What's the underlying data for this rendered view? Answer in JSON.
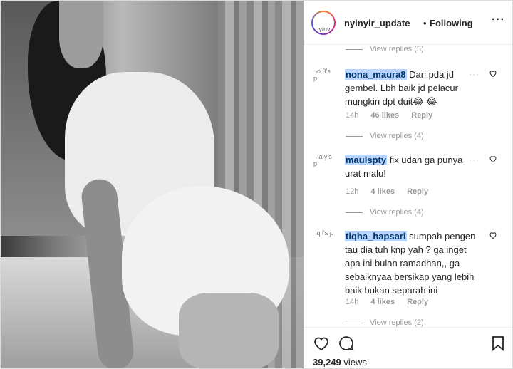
{
  "header": {
    "username": "nyinyir_update",
    "separator": "•",
    "follow_status": "Following",
    "more_label": "···",
    "avatar_alt": "nyinyi"
  },
  "comments": [
    {
      "avatar_alt": "no\n3's p",
      "username": "nona_maura8",
      "text": " Dari pda jd gembel. Lbh baik jd pelacur mungkin dpt duit😂 😂",
      "time": "14h",
      "likes": "46 likes",
      "reply": "Reply",
      "view_replies": "View replies (4)"
    },
    {
      "avatar_alt": "ma\ny's p",
      "username": "maulspty",
      "text": " fix udah ga punya urat malu!",
      "time": "12h",
      "likes": "4 likes",
      "reply": "Reply",
      "view_replies": "View replies (4)"
    },
    {
      "avatar_alt": "tiq\ni's p",
      "username": "tiqha_hapsari",
      "text": " sumpah pengen tau dia tuh knp yah ? ga inget apa ini bulan ramadhan,, ga sebaiknyaa bersikap yang lebih baik bukan separah ini",
      "time": "14h",
      "likes": "4 likes",
      "reply": "Reply",
      "view_replies": "View replies (2)"
    }
  ],
  "top_view_replies": "View replies (5)",
  "footer": {
    "views_count": "39,249",
    "views_label": " views"
  },
  "colors": {
    "mention_highlight": "#b8d4ff",
    "text": "#262626",
    "muted": "#999999"
  }
}
